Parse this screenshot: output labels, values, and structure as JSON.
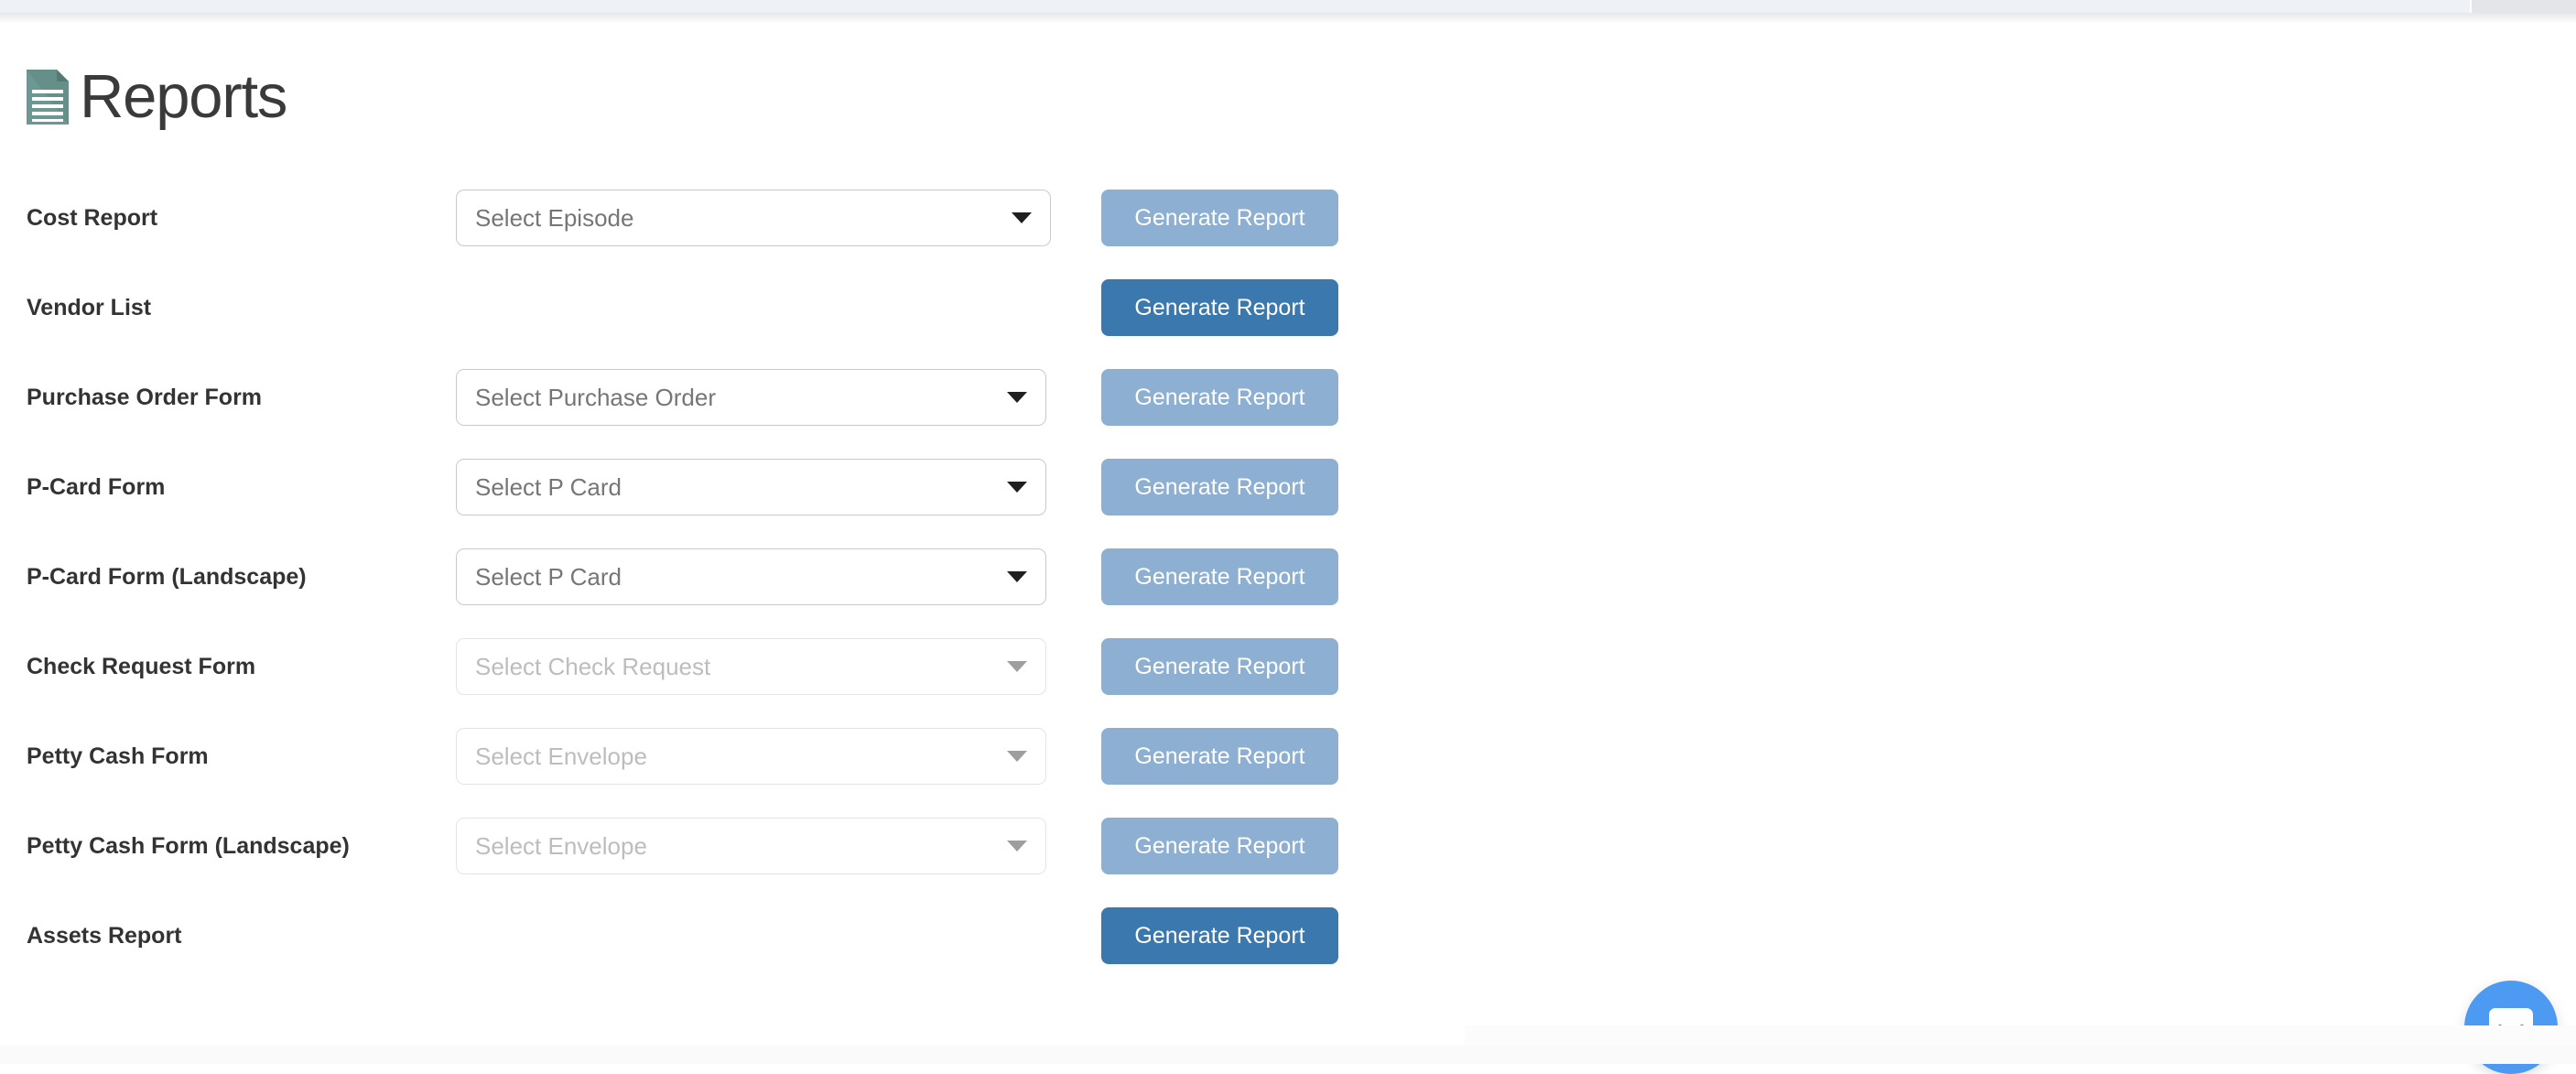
{
  "header": {
    "title": "Reports",
    "icon": "document-report-icon",
    "icon_color": "#6d9792"
  },
  "colors": {
    "button_enabled": "#3b78ad",
    "button_disabled": "#8cafd2",
    "label_text": "#333333",
    "select_text": "#767676",
    "select_text_disabled": "#bdbdbd",
    "chat_launcher": "#4d9af2"
  },
  "rows": [
    {
      "label": "Cost Report",
      "has_select": true,
      "select_placeholder": "Select Episode",
      "select_disabled": false,
      "button_label": "Generate Report",
      "button_enabled": false
    },
    {
      "label": "Vendor List",
      "has_select": false,
      "select_placeholder": "",
      "select_disabled": false,
      "button_label": "Generate Report",
      "button_enabled": true
    },
    {
      "label": "Purchase Order Form",
      "has_select": true,
      "select_placeholder": "Select Purchase Order",
      "select_disabled": false,
      "button_label": "Generate Report",
      "button_enabled": false
    },
    {
      "label": "P-Card Form",
      "has_select": true,
      "select_placeholder": "Select P Card",
      "select_disabled": false,
      "button_label": "Generate Report",
      "button_enabled": false
    },
    {
      "label": "P-Card Form (Landscape)",
      "has_select": true,
      "select_placeholder": "Select P Card",
      "select_disabled": false,
      "button_label": "Generate Report",
      "button_enabled": false
    },
    {
      "label": "Check Request Form",
      "has_select": true,
      "select_placeholder": "Select Check Request",
      "select_disabled": true,
      "button_label": "Generate Report",
      "button_enabled": false
    },
    {
      "label": "Petty Cash Form",
      "has_select": true,
      "select_placeholder": "Select Envelope",
      "select_disabled": true,
      "button_label": "Generate Report",
      "button_enabled": false
    },
    {
      "label": "Petty Cash Form (Landscape)",
      "has_select": true,
      "select_placeholder": "Select Envelope",
      "select_disabled": true,
      "button_label": "Generate Report",
      "button_enabled": false
    },
    {
      "label": "Assets Report",
      "has_select": false,
      "select_placeholder": "",
      "select_disabled": false,
      "button_label": "Generate Report",
      "button_enabled": true
    }
  ],
  "chat_widget": {
    "icon": "chat-bubble-smile-icon"
  }
}
